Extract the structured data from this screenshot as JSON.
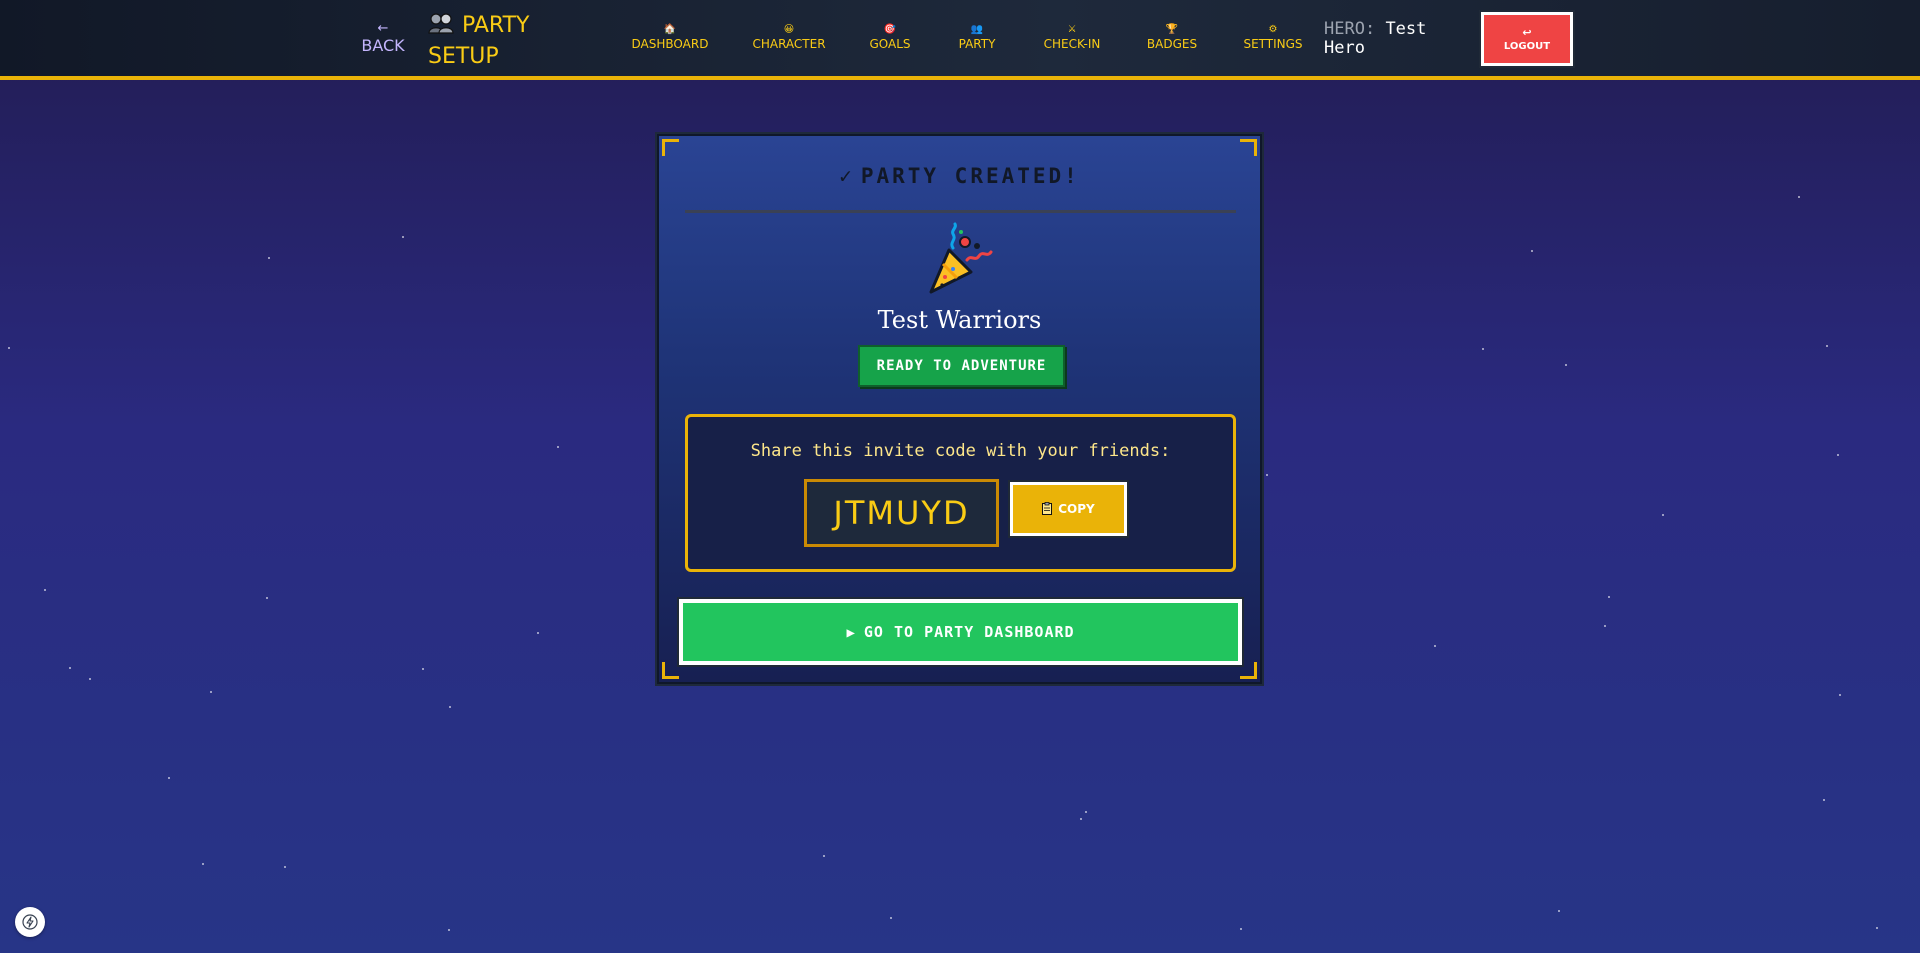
{
  "header": {
    "back_arrow": "←",
    "back_label": "BACK",
    "title_icon": "party-people-icon",
    "title": "PARTY SETUP",
    "nav": [
      {
        "icon": "home-icon",
        "glyph": "🏠",
        "label": "DASHBOARD"
      },
      {
        "icon": "character-icon",
        "glyph": "😀",
        "label": "CHARACTER"
      },
      {
        "icon": "target-icon",
        "glyph": "🎯",
        "label": "GOALS"
      },
      {
        "icon": "party-icon",
        "glyph": "👥",
        "label": "PARTY"
      },
      {
        "icon": "crossed-swords-icon",
        "glyph": "⚔",
        "label": "CHECK-IN"
      },
      {
        "icon": "trophy-icon",
        "glyph": "🏆",
        "label": "BADGES"
      },
      {
        "icon": "gear-icon",
        "glyph": "⚙",
        "label": "SETTINGS"
      }
    ],
    "hero_label": "HERO:",
    "hero_name": "Test Hero",
    "logout_icon": "return-arrow-icon",
    "logout_glyph": "↩",
    "logout_label": "LOGOUT"
  },
  "card": {
    "check": "✓",
    "title": "PARTY CREATED!",
    "party_icon": "party-popper-icon",
    "party_name": "Test Warriors",
    "status": "READY TO ADVENTURE",
    "invite_text": "Share this invite code with your friends:",
    "invite_code": "JTMUYD",
    "copy_icon": "clipboard-icon",
    "copy_label": "COPY",
    "go_icon": "play-icon",
    "go_glyph": "▶",
    "go_label": "GO TO PARTY DASHBOARD"
  },
  "colors": {
    "accent": "#eab308",
    "title_text": "#facc15",
    "success": "#22c55e",
    "status_badge": "#16a34a",
    "danger": "#ef4444",
    "nav_text": "#facc15",
    "back_text": "#c4b5fd"
  },
  "floating": {
    "icon": "lightning-icon"
  }
}
